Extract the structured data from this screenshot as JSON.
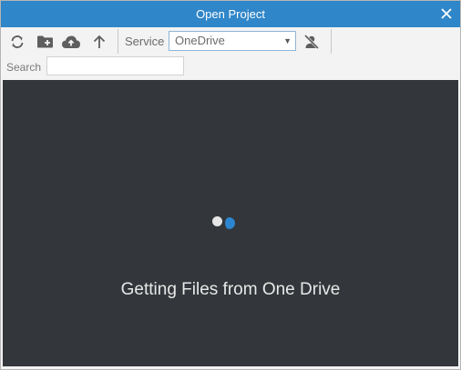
{
  "window": {
    "title": "Open Project"
  },
  "toolbar": {
    "buttons": [
      {
        "icon": "refresh-icon"
      },
      {
        "icon": "new-folder-icon"
      },
      {
        "icon": "upload-cloud-icon"
      },
      {
        "icon": "arrow-up-icon"
      }
    ],
    "service_label": "Service",
    "service_value": "OneDrive",
    "sign_out_icon": "user-off-icon"
  },
  "search": {
    "label": "Search",
    "value": ""
  },
  "content": {
    "status_text": "Getting Files from One Drive"
  },
  "colors": {
    "titlebar": "#2f86c9",
    "content_bg": "#33373b",
    "spinner_accent": "#2c86cf"
  }
}
